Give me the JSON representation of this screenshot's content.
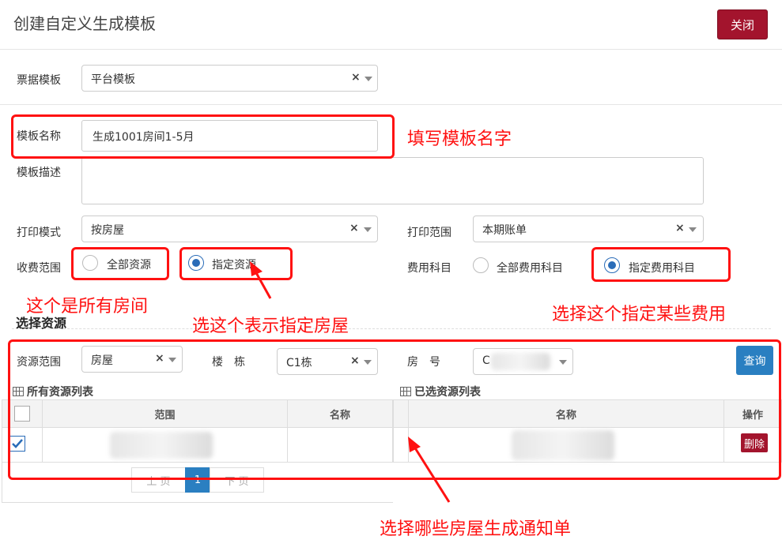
{
  "dialog": {
    "title": "创建自定义生成模板",
    "close_label": "关闭"
  },
  "form": {
    "ticket_template": {
      "label": "票据模板",
      "value": "平台模板"
    },
    "template_name": {
      "label": "模板名称",
      "value": "生成1001房间1-5月"
    },
    "template_desc": {
      "label": "模板描述",
      "value": ""
    },
    "print_mode": {
      "label": "打印模式",
      "value": "按房屋"
    },
    "print_range": {
      "label": "打印范围",
      "value": "本期账单"
    },
    "charge_scope": {
      "label": "收费范围",
      "options": [
        "全部资源",
        "指定资源"
      ],
      "selected": "指定资源"
    },
    "fee_items": {
      "label": "费用科目",
      "options": [
        "全部费用科目",
        "指定费用科目"
      ],
      "selected": "指定费用科目"
    }
  },
  "resource": {
    "section_title": "选择资源",
    "scope": {
      "label": "资源范围",
      "value": "房屋"
    },
    "building": {
      "label": "楼　栋",
      "value": "C1栋"
    },
    "room": {
      "label": "房　号",
      "value": "C"
    },
    "query_label": "查询",
    "all_list": {
      "title": "所有资源列表",
      "columns": [
        "范围",
        "名称"
      ]
    },
    "selected_list": {
      "title": "已选资源列表",
      "columns": [
        "名称",
        "操作"
      ],
      "delete_label": "删除"
    },
    "pager": {
      "prev": "上 页",
      "current": "1",
      "next": "下 页"
    }
  },
  "annotations": {
    "name_hint": "填写模板名字",
    "all_resource_hint": "这个是所有房间",
    "specify_resource_hint": "选这个表示指定房屋",
    "fee_hint": "选择这个指定某些费用",
    "list_hint": "选择哪些房屋生成通知单"
  },
  "colors": {
    "primary": "#2a7fc1",
    "danger": "#a3142d",
    "annotation": "#ff1111"
  }
}
